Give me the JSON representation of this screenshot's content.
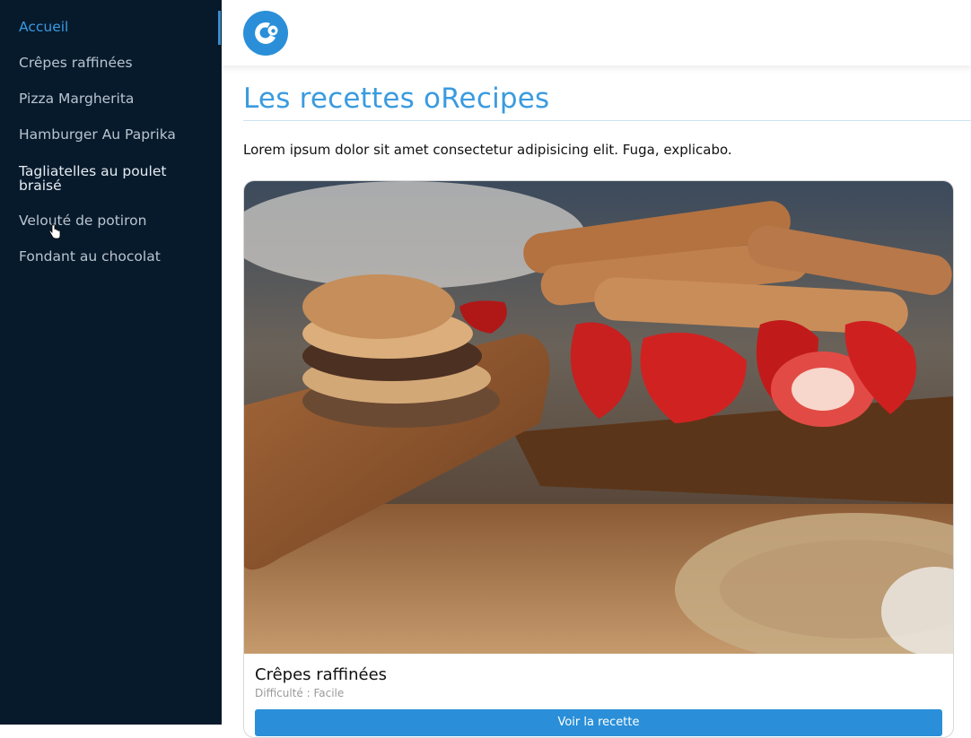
{
  "sidebar": {
    "items": [
      {
        "label": "Accueil",
        "state": "active"
      },
      {
        "label": "Crêpes raffinées",
        "state": "normal"
      },
      {
        "label": "Pizza Margherita",
        "state": "normal"
      },
      {
        "label": "Hamburger Au Paprika",
        "state": "normal"
      },
      {
        "label": "Tagliatelles au poulet braisé",
        "state": "hover"
      },
      {
        "label": "Velouté de potiron",
        "state": "normal"
      },
      {
        "label": "Fondant au chocolat",
        "state": "normal"
      }
    ]
  },
  "header": {
    "logo_icon": "orecipes-logo-icon"
  },
  "main": {
    "title": "Les recettes oRecipes",
    "intro": "Lorem ipsum dolor sit amet consectetur adipisicing elit. Fuga, explicabo."
  },
  "card": {
    "image": "crepes-strawberries-photo",
    "title": "Crêpes raffinées",
    "difficulty": "Difficulté : Facile",
    "button_label": "Voir la recette"
  },
  "colors": {
    "sidebar_bg": "#071a2c",
    "accent": "#3a9be0",
    "button": "#2a8fd8"
  }
}
